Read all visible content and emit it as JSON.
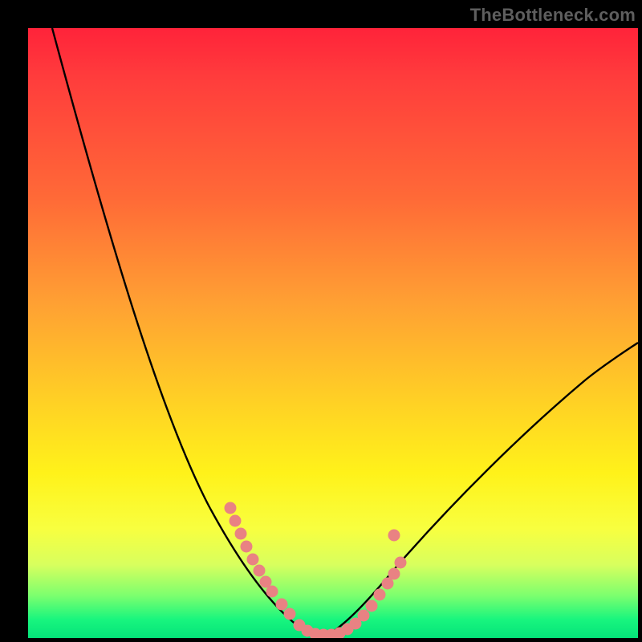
{
  "watermark": "TheBottleneck.com",
  "chart_data": {
    "type": "line",
    "title": "",
    "xlabel": "",
    "ylabel": "",
    "xlim": [
      0,
      100
    ],
    "ylim": [
      0,
      100
    ],
    "grid": false,
    "series": [
      {
        "name": "bottleneck-curve-left",
        "color": "#000000",
        "x": [
          4,
          13,
          22,
          30,
          35,
          39,
          43,
          48
        ],
        "values": [
          100,
          66,
          37,
          22,
          15,
          10,
          5,
          1
        ]
      },
      {
        "name": "bottleneck-curve-right",
        "color": "#000000",
        "x": [
          48,
          52,
          58,
          66,
          75,
          85,
          95,
          100
        ],
        "values": [
          1,
          3,
          8,
          16,
          25,
          35,
          44,
          48
        ]
      },
      {
        "name": "scatter-markers",
        "type": "scatter",
        "color": "#e98283",
        "x": [
          33,
          34,
          35,
          36,
          37,
          38,
          39,
          40,
          42,
          43,
          45,
          46,
          47,
          48,
          49,
          50,
          51,
          52,
          53,
          54,
          55,
          56,
          57,
          58,
          60
        ],
        "values": [
          22,
          20,
          18,
          16,
          14,
          13,
          11,
          10,
          8,
          6,
          3,
          2,
          2,
          1,
          1,
          1,
          2,
          2,
          3,
          4,
          6,
          8,
          10,
          12,
          17
        ]
      }
    ],
    "colors": {
      "gradient_top": "#ff233a",
      "gradient_mid": "#ffd324",
      "gradient_bottom": "#04e37a",
      "marker": "#e98283",
      "curve": "#000000"
    }
  }
}
